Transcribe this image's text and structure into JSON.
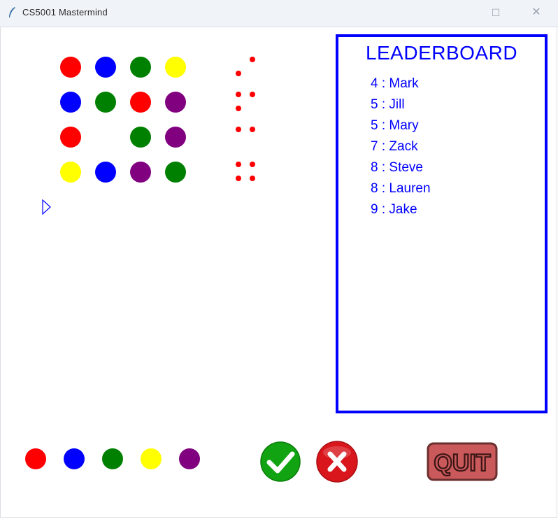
{
  "window": {
    "title": "CS5001 Mastermind",
    "maximize_glyph": "☐",
    "close_glyph": "✕"
  },
  "colors": {
    "red": "#ff0000",
    "blue": "#0000ff",
    "green": "#008000",
    "yellow": "#ffff00",
    "purple": "#800080"
  },
  "board": {
    "guesses": [
      [
        "red",
        "blue",
        "green",
        "yellow"
      ],
      [
        "blue",
        "green",
        "red",
        "purple"
      ],
      [
        "red",
        null,
        "green",
        "purple"
      ],
      [
        "yellow",
        "blue",
        "purple",
        "green"
      ]
    ],
    "feedback_pegs_shown": [
      2,
      3,
      2,
      4
    ]
  },
  "leaderboard": {
    "title": "LEADERBOARD",
    "entries": [
      "4 : Mark",
      "5 : Jill",
      "5 : Mary",
      "7 : Zack",
      "8 : Steve",
      "8 : Lauren",
      "9 : Jake"
    ]
  },
  "controls": {
    "color_choices": [
      "red",
      "blue",
      "green",
      "yellow",
      "purple"
    ],
    "submit_icon": "check-icon",
    "reset_icon": "x-icon",
    "quit_label": "QUIT"
  }
}
